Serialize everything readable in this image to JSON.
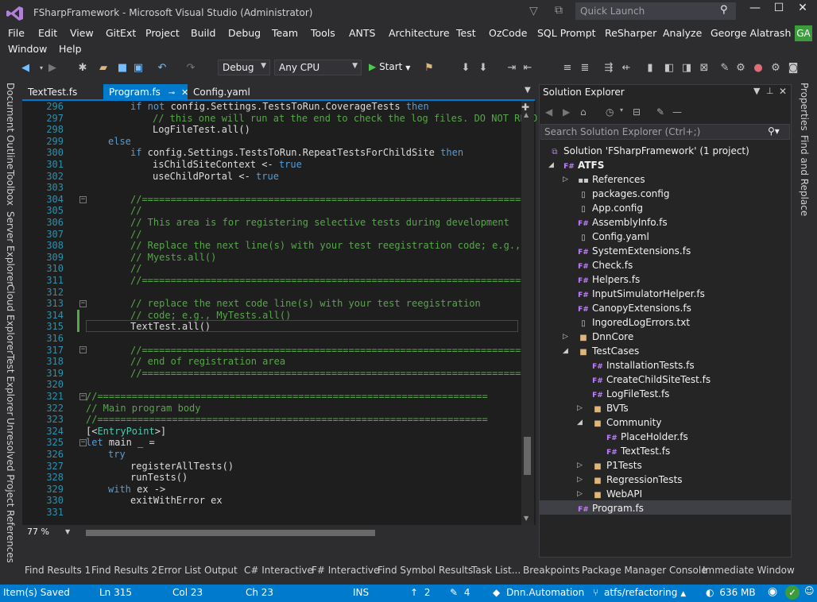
{
  "window": {
    "title": "FSharpFramework - Microsoft Visual Studio (Administrator)",
    "quick_launch_placeholder": "Quick Launch",
    "user": "George Alatrash",
    "avatar_initials": "GA"
  },
  "menu": {
    "items": [
      "File",
      "Edit",
      "View",
      "GitExt",
      "Project",
      "Build",
      "Debug",
      "Team",
      "Tools",
      "ANTS",
      "Architecture",
      "Test",
      "OzCode",
      "SQL Prompt",
      "ReSharper",
      "Analyze"
    ],
    "row2": [
      "Window",
      "Help"
    ]
  },
  "toolbar": {
    "config": "Debug",
    "platform": "Any CPU",
    "start_label": "Start"
  },
  "left_tabs": [
    "Document Outline",
    "Toolbox",
    "Server Explorer",
    "Cloud Explorer",
    "Test Explorer",
    "Unresolved Project References"
  ],
  "right_tabs": [
    "Properties",
    "Find and Replace"
  ],
  "doc_tabs": [
    "TextTest.fs",
    "Program.fs",
    "Config.yaml"
  ],
  "editor": {
    "zoom": "77 %",
    "lines": [
      {
        "n": "296",
        "t": "if not config.Settings.TestsToRun.CoverageTests then"
      },
      {
        "n": "297",
        "t": "// this one will run at the end to check the log files. DO NOT REMO"
      },
      {
        "n": "298",
        "t": "LogFileTest.all()"
      },
      {
        "n": "299",
        "t": "else"
      },
      {
        "n": "300",
        "t": "if config.Settings.TestsToRun.RepeatTestsForChildSite then"
      },
      {
        "n": "301",
        "t": "isChildSiteContext <- true"
      },
      {
        "n": "302",
        "t": "useChildPortal <- true"
      },
      {
        "n": "303",
        "t": ""
      },
      {
        "n": "304",
        "t": "//==================================================================="
      },
      {
        "n": "305",
        "t": "//"
      },
      {
        "n": "306",
        "t": "// This area is for registering selective tests during development"
      },
      {
        "n": "307",
        "t": "//"
      },
      {
        "n": "308",
        "t": "// Replace the next line(s) with your test reegistration code; e.g.,"
      },
      {
        "n": "309",
        "t": "// Myests.all()"
      },
      {
        "n": "310",
        "t": "//"
      },
      {
        "n": "311",
        "t": "//==================================================================="
      },
      {
        "n": "312",
        "t": ""
      },
      {
        "n": "313",
        "t": "// replace the next code line(s) with your test reegistration"
      },
      {
        "n": "314",
        "t": "// code; e.g., MyTests.all()"
      },
      {
        "n": "315",
        "t": "TextTest.all()"
      },
      {
        "n": "316",
        "t": ""
      },
      {
        "n": "317",
        "t": "//==================================================================="
      },
      {
        "n": "318",
        "t": "// end of registration area"
      },
      {
        "n": "319",
        "t": "//==================================================================="
      },
      {
        "n": "320",
        "t": ""
      },
      {
        "n": "321",
        "t": "//===================================================================="
      },
      {
        "n": "322",
        "t": "// Main program body"
      },
      {
        "n": "323",
        "t": "//===================================================================="
      },
      {
        "n": "324",
        "t": "[<EntryPoint>]"
      },
      {
        "n": "325",
        "t": "let main _ ="
      },
      {
        "n": "326",
        "t": "try"
      },
      {
        "n": "327",
        "t": "registerAllTests()"
      },
      {
        "n": "328",
        "t": "runTests()"
      },
      {
        "n": "329",
        "t": "with ex ->"
      },
      {
        "n": "330",
        "t": "exitWithError ex"
      },
      {
        "n": "331",
        "t": ""
      }
    ]
  },
  "solution_explorer": {
    "title": "Solution Explorer",
    "search_placeholder": "Search Solution Explorer (Ctrl+;)",
    "items": [
      {
        "label": "Solution 'FSharpFramework' (1 project)"
      },
      {
        "label": "ATFS"
      },
      {
        "label": "References"
      },
      {
        "label": "packages.config"
      },
      {
        "label": "App.config"
      },
      {
        "label": "AssemblyInfo.fs"
      },
      {
        "label": "Config.yaml"
      },
      {
        "label": "SystemExtensions.fs"
      },
      {
        "label": "Check.fs"
      },
      {
        "label": "Helpers.fs"
      },
      {
        "label": "InputSimulatorHelper.fs"
      },
      {
        "label": "CanopyExtensions.fs"
      },
      {
        "label": "IngoredLogErrors.txt"
      },
      {
        "label": "DnnCore"
      },
      {
        "label": "TestCases"
      },
      {
        "label": "InstallationTests.fs"
      },
      {
        "label": "CreateChildSiteTest.fs"
      },
      {
        "label": "LogFileTest.fs"
      },
      {
        "label": "BVTs"
      },
      {
        "label": "Community"
      },
      {
        "label": "PlaceHolder.fs"
      },
      {
        "label": "TextTest.fs"
      },
      {
        "label": "P1Tests"
      },
      {
        "label": "RegressionTests"
      },
      {
        "label": "WebAPI"
      },
      {
        "label": "Program.fs"
      }
    ]
  },
  "bottom_tabs": [
    "Find Results 1",
    "Find Results 2",
    "Error List",
    "Output",
    "C# Interactive",
    "F# Interactive",
    "Find Symbol Results",
    "Task List...",
    "Breakpoints",
    "Package Manager Console",
    "Immediate Window"
  ],
  "status": {
    "message": "Item(s) Saved",
    "ln": "Ln 315",
    "col": "Col 23",
    "ch": "Ch 23",
    "mode": "INS",
    "push_count": "2",
    "edit_count": "4",
    "repo": "Dnn.Automation",
    "branch": "atfs/refactoring",
    "memory": "636 MB"
  }
}
